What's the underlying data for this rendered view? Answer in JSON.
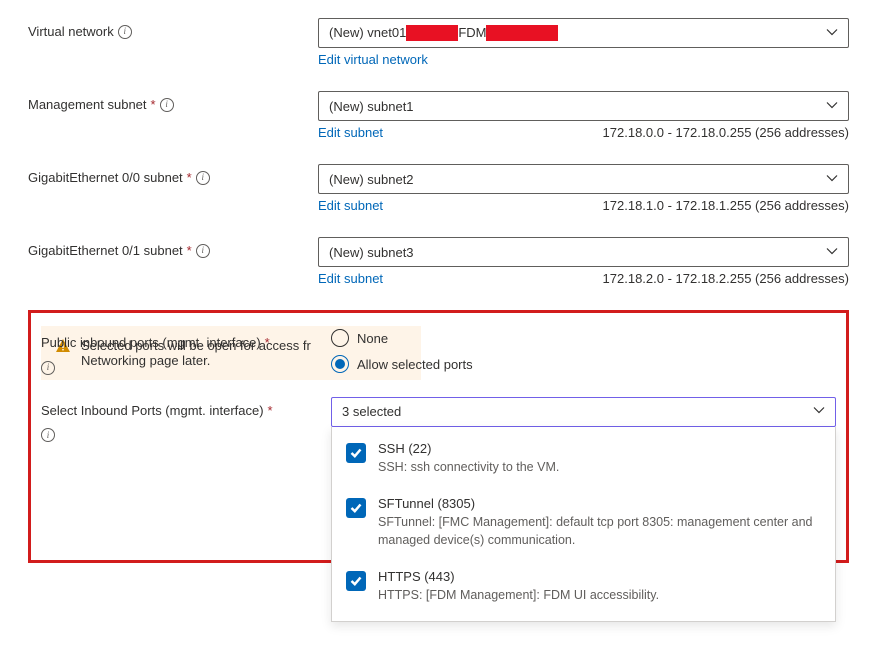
{
  "rows": {
    "vnet": {
      "label": "Virtual network",
      "value_prefix": "(New) vnet01",
      "value_mid": "FDM",
      "edit_link": "Edit virtual network"
    },
    "mgmt": {
      "label": "Management subnet",
      "value": "(New) subnet1",
      "edit_link": "Edit subnet",
      "range": "172.18.0.0 - 172.18.0.255 (256 addresses)"
    },
    "ge00": {
      "label": "GigabitEthernet 0/0 subnet",
      "value": "(New) subnet2",
      "edit_link": "Edit subnet",
      "range": "172.18.1.0 - 172.18.1.255 (256 addresses)"
    },
    "ge01": {
      "label": "GigabitEthernet 0/1 subnet",
      "value": "(New) subnet3",
      "edit_link": "Edit subnet",
      "range": "172.18.2.0 - 172.18.2.255 (256 addresses)"
    }
  },
  "inbound": {
    "label": "Public inbound ports (mgmt. interface)",
    "option_none": "None",
    "option_allow": "Allow selected ports"
  },
  "select_ports": {
    "label": "Select Inbound Ports (mgmt. interface)",
    "summary": "3 selected",
    "items": [
      {
        "title": "SSH (22)",
        "desc": "SSH: ssh connectivity to the VM."
      },
      {
        "title": "SFTunnel (8305)",
        "desc": "SFTunnel: [FMC Management]: default tcp port 8305: management center and managed device(s) communication."
      },
      {
        "title": "HTTPS (443)",
        "desc": "HTTPS: [FDM Management]: FDM UI accessibility."
      }
    ]
  },
  "warning": {
    "line1": "Selected ports will be open for access fr",
    "line2": "Networking page later."
  }
}
